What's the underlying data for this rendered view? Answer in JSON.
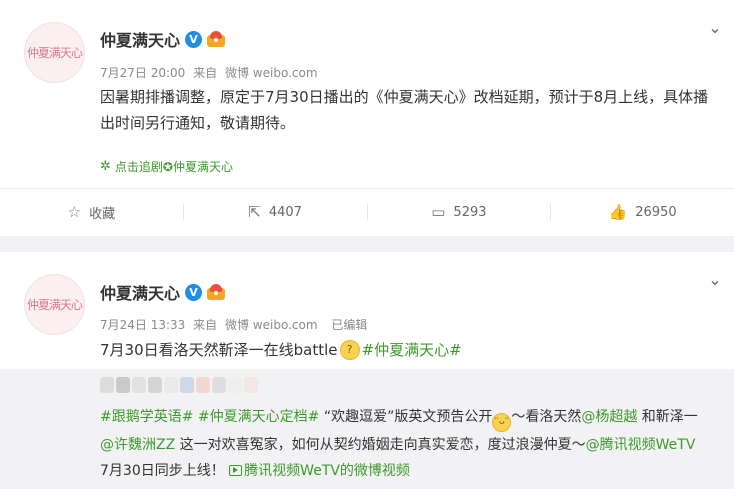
{
  "posts": [
    {
      "avatar_text": "仲夏满天心",
      "author": "仲夏满天心",
      "verified_badge": "V",
      "meta": {
        "date": "7月27日 20:00",
        "via_label": "来自",
        "source": "微博 weibo.com"
      },
      "text": "因暑期排播调整，原定于7月30日播出的《仲夏满天心》改档延期，预计于8月上线，具体播出时间另行通知，敬请期待。",
      "topic_link": "点击追剧✪仲夏满天心",
      "actions": {
        "favorite": "收藏",
        "repost": "4407",
        "comment": "5293",
        "like": "26950"
      }
    },
    {
      "avatar_text": "仲夏满天心",
      "author": "仲夏满天心",
      "verified_badge": "V",
      "meta": {
        "date": "7月24日 13:33",
        "via_label": "来自",
        "source": "微博 weibo.com",
        "edited": "已编辑"
      },
      "text_prefix": "7月30日看洛天然靳泽一在线battle",
      "text_hashtag": "#仲夏满天心#",
      "repost": {
        "text_parts": {
          "tags": "#跟鹅学英语# #仲夏满天心定档#",
          "mid1": " “欢趣逗爱”版英文预告公开",
          "mid2": "～看洛天然",
          "mention1": "@杨超越",
          "mid3": " 和靳泽一",
          "mention2": "@许魏洲ZZ",
          "mid4": " 这一对欢喜冤家，如何从契约婚姻走向真实爱恋，度过浪漫仲夏～",
          "mention3": "@腾讯视频WeTV",
          "mid5": " 7月30日同步上线！ ",
          "video_link": "腾讯视频WeTV的微博视频"
        }
      }
    }
  ],
  "colors": {
    "accent_green": "#3d9a2a",
    "verified_blue": "#1e8fe5",
    "meta_gray": "#8a8a8a"
  },
  "icons": {
    "more": "chevron-down-icon",
    "favorite": "star-icon",
    "repost": "share-arrow-icon",
    "comment": "comment-icon",
    "like": "thumbs-up-icon"
  }
}
